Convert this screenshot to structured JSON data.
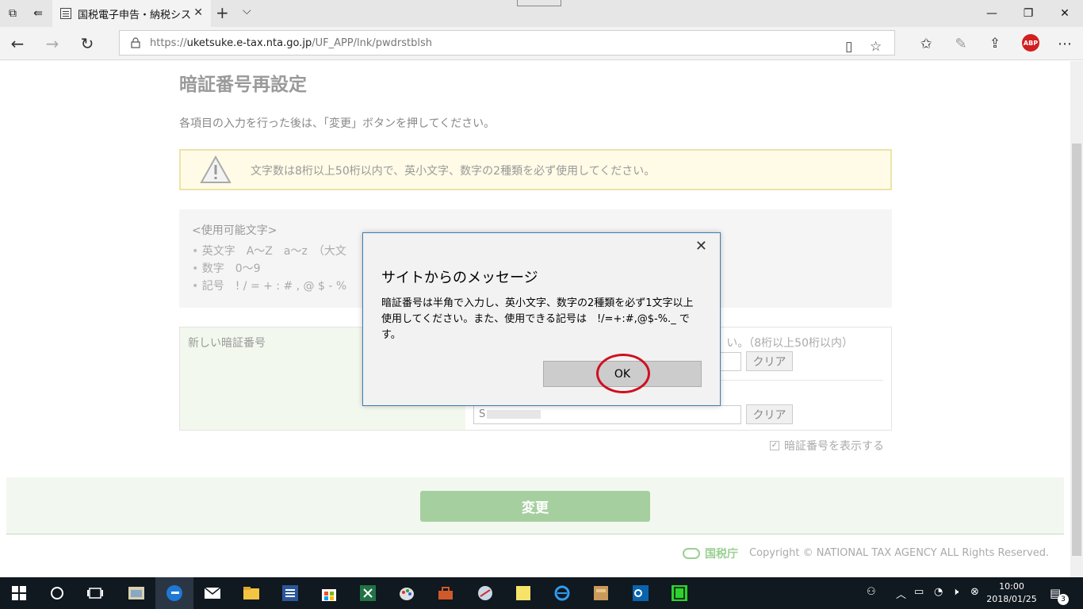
{
  "browser": {
    "tab_title": "国税電子申告・納税シス"
  },
  "address_bar": {
    "protocol": "https://",
    "host": "uketsuke.e-tax.nta.go.jp",
    "path": "/UF_APP/lnk/pwdrstblsh"
  },
  "extension": {
    "abp_label": "ABP"
  },
  "page": {
    "title": "暗証番号再設定",
    "instruction": "各項目の入力を行った後は、「変更」ボタンを押してください。",
    "warning": "文字数は8桁以上50桁以内で、英小文字、数字の2種類を必ず使用してください。",
    "usable_chars_heading": "<使用可能文字>",
    "usable_chars": [
      "英文字　A～Z　a～z　（大文",
      "数字　0～9",
      "記号　! / = + : # , @ $ - %"
    ],
    "new_pin_label": "新しい暗証番号",
    "length_hint": "い。（8桁以上50桁以内）",
    "confirm_value": "S",
    "clear_label": "クリア",
    "show_pin_label": "暗証番号を表示する",
    "change_button": "変更",
    "footer_org": "国税庁",
    "copyright": "Copyright © NATIONAL TAX AGENCY ALL Rights Reserved."
  },
  "dialog": {
    "title": "サイトからのメッセージ",
    "body": "暗証番号は半角で入力し、英小文字、数字の2種類を必ず1文字以上使用してください。また、使用できる記号は　!/=+:#,@$-%._ です。",
    "ok_label": "OK",
    "highlight_color": "#d01020"
  },
  "taskbar": {
    "time": "10:00",
    "date": "2018/01/25",
    "notification_count": "3"
  }
}
